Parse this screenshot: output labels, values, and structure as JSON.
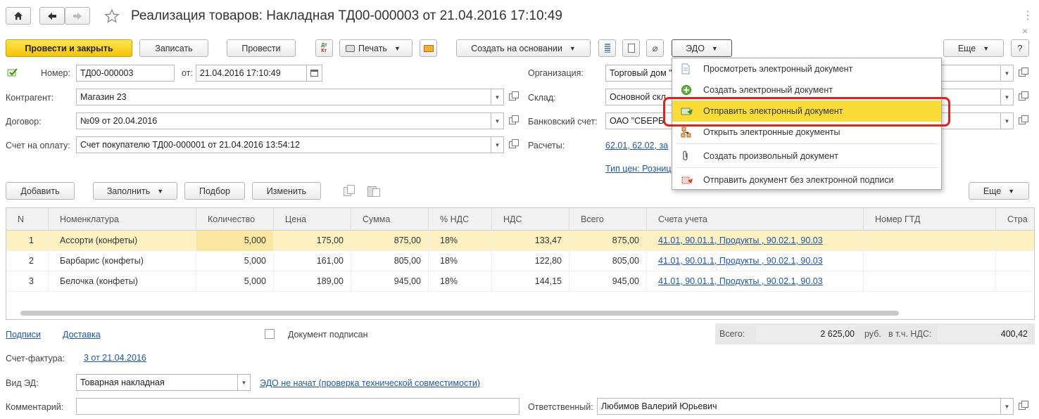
{
  "window": {
    "title": "Реализация товаров: Накладная ТД00-000003 от 21.04.2016 17:10:49"
  },
  "toolbar": {
    "post_close": "Провести и закрыть",
    "save": "Записать",
    "post": "Провести",
    "print": "Печать",
    "create_based": "Создать на основании",
    "edo": "ЭДО",
    "more": "Еще",
    "help": "?"
  },
  "form": {
    "number_label": "Номер:",
    "number_value": "ТД00-000003",
    "date_label": "от:",
    "date_value": "21.04.2016 17:10:49",
    "org_label": "Организация:",
    "org_value": "Торговый дом \"",
    "counterparty_label": "Контрагент:",
    "counterparty_value": "Магазин 23",
    "warehouse_label": "Склад:",
    "warehouse_value": "Основной скл",
    "contract_label": "Договор:",
    "contract_value": "№09 от 20.04.2016",
    "bank_label": "Банковский счет:",
    "bank_value": "ОАО \"СБЕРБ",
    "invoice_label": "Счет на оплату:",
    "invoice_value": "Счет покупателю ТД00-000001 от 21.04.2016 13:54:12",
    "settlements_label": "Расчеты:",
    "settlements_link": "62.01, 62.02, за",
    "price_type_link": "Тип цен: Розниц"
  },
  "edo_menu": {
    "items": [
      {
        "label": "Просмотреть электронный документ"
      },
      {
        "label": "Создать электронный документ"
      },
      {
        "label": "Отправить электронный документ"
      },
      {
        "label": "Открыть электронные документы"
      },
      {
        "label": "Создать произвольный документ"
      },
      {
        "label": "Отправить документ без электронной подписи"
      }
    ]
  },
  "table_toolbar": {
    "add": "Добавить",
    "fill": "Заполнить",
    "pick": "Подбор",
    "change": "Изменить",
    "more": "Еще"
  },
  "table": {
    "columns": [
      "N",
      "Номенклатура",
      "Количество",
      "Цена",
      "Сумма",
      "% НДС",
      "НДС",
      "Всего",
      "Счета учета",
      "Номер ГТД",
      "Стра"
    ],
    "rows": [
      {
        "n": "1",
        "name": "Ассорти (конфеты)",
        "qty": "5,000",
        "price": "175,00",
        "sum": "875,00",
        "vat_rate": "18%",
        "vat": "133,47",
        "total": "875,00",
        "accounts": "41.01, 90.01.1, Продукты , 90.02.1, 90.03"
      },
      {
        "n": "2",
        "name": "Барбарис (конфеты)",
        "qty": "5,000",
        "price": "161,00",
        "sum": "805,00",
        "vat_rate": "18%",
        "vat": "122,80",
        "total": "805,00",
        "accounts": "41.01, 90.01.1, Продукты , 90.02.1, 90.03"
      },
      {
        "n": "3",
        "name": "Белочка (конфеты)",
        "qty": "5,000",
        "price": "189,00",
        "sum": "945,00",
        "vat_rate": "18%",
        "vat": "144,15",
        "total": "945,00",
        "accounts": "41.01, 90.01.1, Продукты , 90.02.1, 90.03"
      }
    ]
  },
  "footer": {
    "signatures_link": "Подписи",
    "delivery_link": "Доставка",
    "signed_label": "Документ подписан",
    "total_label": "Всего:",
    "total_value": "2 625,00",
    "currency": "руб.",
    "vat_label": "в т.ч. НДС:",
    "vat_value": "400,42",
    "invoice_label": "Счет-фактура:",
    "invoice_link": "3 от 21.04.2016",
    "ed_type_label": "Вид ЭД:",
    "ed_type_value": "Товарная накладная",
    "edo_status_link": "ЭДО не начат (проверка технической совместимости)",
    "comment_label": "Комментарий:",
    "comment_value": "",
    "responsible_label": "Ответственный:",
    "responsible_value": "Любимов Валерий Юрьевич"
  },
  "colors": {
    "primary_button": "#f5c400",
    "menu_highlight": "#f9dc37",
    "selected_row": "#fdf1c1",
    "link": "#1f56b4",
    "annotation_red": "#e3201b"
  }
}
